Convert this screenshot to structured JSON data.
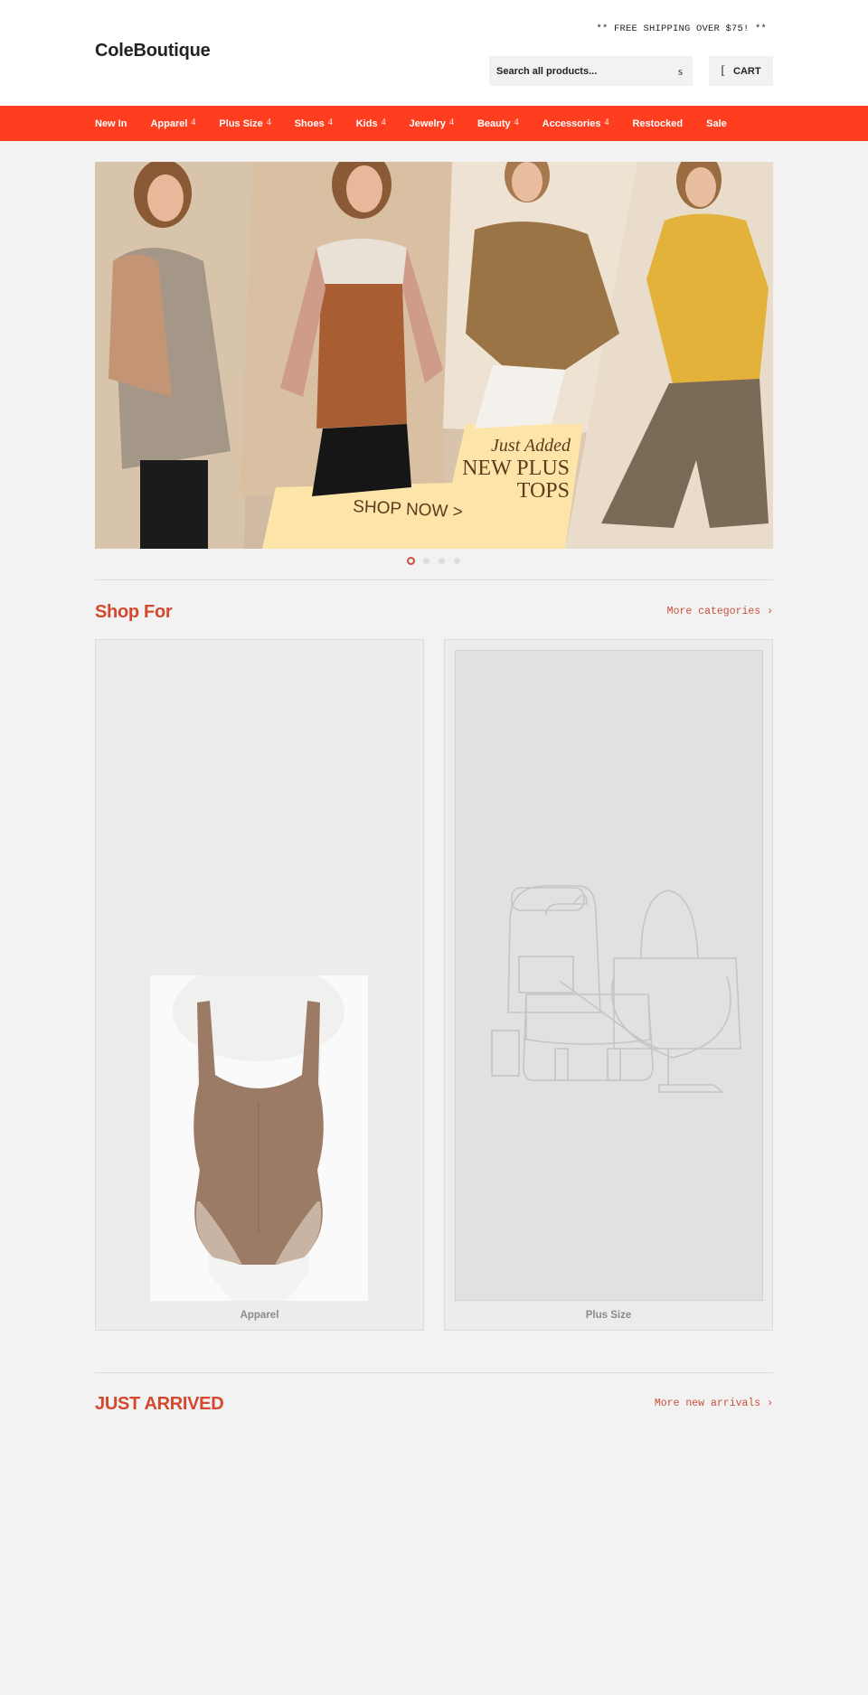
{
  "header": {
    "logo": "ColeBoutique",
    "promo": "** FREE SHIPPING OVER $75! **",
    "search": {
      "placeholder": "Search all products...",
      "icon": "search-icon",
      "icon_glyph": "s"
    },
    "cart": {
      "label": "CART",
      "icon": "cart-icon",
      "icon_glyph": "["
    }
  },
  "nav": {
    "items": [
      {
        "label": "New In",
        "has_dropdown": false
      },
      {
        "label": "Apparel",
        "has_dropdown": true
      },
      {
        "label": "Plus Size",
        "has_dropdown": true
      },
      {
        "label": "Shoes",
        "has_dropdown": true
      },
      {
        "label": "Kids",
        "has_dropdown": true
      },
      {
        "label": "Jewelry",
        "has_dropdown": true
      },
      {
        "label": "Beauty",
        "has_dropdown": true
      },
      {
        "label": "Accessories",
        "has_dropdown": true
      },
      {
        "label": "Restocked",
        "has_dropdown": false
      },
      {
        "label": "Sale",
        "has_dropdown": false
      }
    ],
    "caret_glyph": "4",
    "background": "#ff3e1f"
  },
  "hero": {
    "tagline": "Just Added",
    "headline_line1": "NEW PLUS",
    "headline_line2": "TOPS",
    "cta": "SHOP NOW >",
    "slides_total": 4,
    "active_slide": 1
  },
  "shop_for": {
    "title": "Shop For",
    "link": "More categories ›",
    "categories": [
      {
        "label": "Apparel",
        "image": "bodysuit-product-photo"
      },
      {
        "label": "Plus Size",
        "image": "bags-placeholder-illustration"
      }
    ]
  },
  "just_arrived": {
    "title": "JUST ARRIVED",
    "link": "More new arrivals ›"
  },
  "colors": {
    "accent": "#d4492e",
    "nav_bg": "#ff3e1f",
    "page_bg": "#f2f2f2"
  }
}
